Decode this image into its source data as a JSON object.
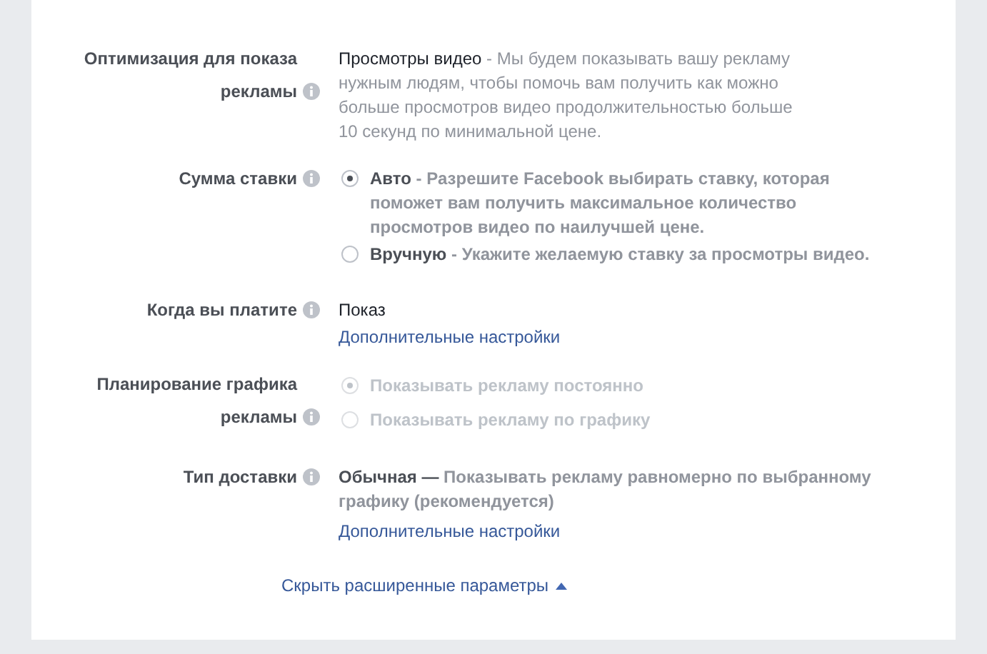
{
  "rows": [
    {
      "kind": "description",
      "label": "Оптимизация для показа рекламы",
      "title": "Просмотры видео",
      "text": " - Мы будем показывать вашу рекламу нужным людям, чтобы помочь вам получить как можно больше просмотров видео продолжительностью больше 10 секунд по минимальной цене."
    },
    {
      "kind": "radio",
      "label": "Сумма ставки",
      "disabled": false,
      "options": [
        {
          "title": "Авто",
          "text": " - Разрешите Facebook выбирать ставку, которая поможет вам получить максимальное количество просмотров видео по наилучшей цене.",
          "selected": true
        },
        {
          "title": "Вручную",
          "text": " - Укажите желаемую ставку за просмотры видео.",
          "selected": false
        }
      ]
    },
    {
      "kind": "value",
      "label": "Когда вы платите",
      "value": "Показ",
      "link": "Дополнительные настройки"
    },
    {
      "kind": "radio",
      "label": "Планирование графика рекламы",
      "disabled": true,
      "options": [
        {
          "text": "Показывать рекламу постоянно",
          "selected": true
        },
        {
          "text": "Показывать рекламу по графику",
          "selected": false
        }
      ]
    },
    {
      "kind": "summary",
      "label": "Тип доставки",
      "title": "Обычная —",
      "text": " Показывать рекламу равномерно по выбранному графику (рекомендуется)",
      "link": "Дополнительные настройки"
    }
  ],
  "footer_link": "Скрыть расширенные параметры"
}
